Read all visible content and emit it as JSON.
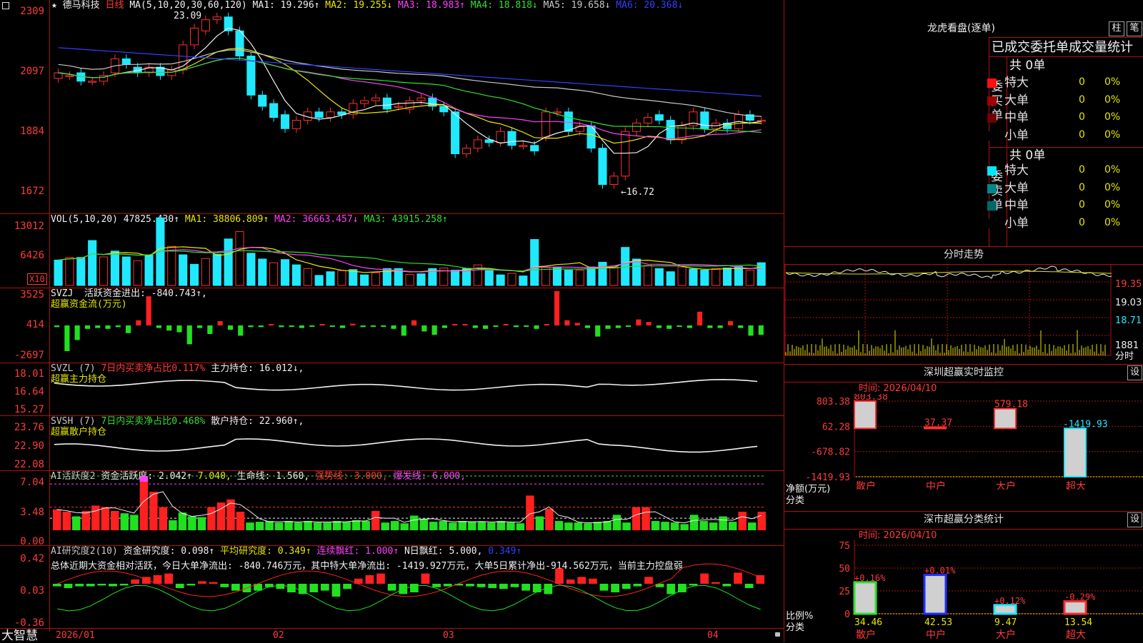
{
  "app": {
    "brand": "大智慧",
    "date_axis": [
      "2026/01",
      "02",
      "03",
      "04"
    ],
    "corner_icon": "lock-icon"
  },
  "kline": {
    "title_star": "★",
    "stock": "德马科技",
    "period": "日线",
    "ma_label": "MA(5,10,20,30,60,120)",
    "ma1": "MA1: 19.296↑",
    "ma2": "MA2: 19.255↓",
    "ma3": "MA3: 18.983↑",
    "ma4": "MA4: 18.818↓",
    "ma5": "MA5: 19.658↓",
    "ma6": "MA6: 20.368↓",
    "y_ticks": [
      "2309",
      "2097",
      "1884",
      "1672"
    ],
    "high_marker": "23.09",
    "low_marker": "←16.72",
    "closes": [
      21.0,
      20.9,
      20.7,
      20.7,
      20.9,
      21.5,
      21.3,
      21.0,
      21.2,
      20.9,
      21.1,
      22.0,
      22.6,
      22.9,
      23.0,
      22.5,
      21.6,
      20.2,
      19.8,
      19.4,
      19.0,
      19.3,
      19.6,
      19.4,
      19.6,
      19.5,
      19.9,
      20.0,
      20.1,
      19.7,
      19.8,
      20.0,
      20.1,
      19.8,
      19.6,
      18.1,
      18.3,
      18.6,
      18.5,
      18.9,
      18.4,
      18.4,
      18.2,
      19.6,
      19.6,
      18.9,
      19.1,
      18.3,
      17.0,
      17.3,
      18.9,
      19.2,
      19.4,
      19.3,
      18.6,
      19.1,
      19.6,
      19.0,
      19.2,
      19.0,
      19.5,
      19.3,
      19.3
    ],
    "opens": [
      20.8,
      20.9,
      21.0,
      20.7,
      20.7,
      21.0,
      21.5,
      21.2,
      21.0,
      21.2,
      20.9,
      21.1,
      22.0,
      22.5,
      22.9,
      23.0,
      22.5,
      21.6,
      20.2,
      19.9,
      19.5,
      19.0,
      19.3,
      19.6,
      19.4,
      19.6,
      19.5,
      19.9,
      20.0,
      20.1,
      19.8,
      19.7,
      20.0,
      20.1,
      19.8,
      19.6,
      18.1,
      18.3,
      18.6,
      18.5,
      18.9,
      18.4,
      18.4,
      18.7,
      19.6,
      19.6,
      18.9,
      19.1,
      18.3,
      17.0,
      17.3,
      18.9,
      19.2,
      19.5,
      19.3,
      18.6,
      19.1,
      19.6,
      19.0,
      19.2,
      19.0,
      19.5,
      19.3
    ]
  },
  "volume": {
    "label": "VOL(5,10,20)",
    "value": "47825.430↑",
    "ma1": "MA1: 38806.809↑",
    "ma2": "MA2: 36663.457↓",
    "ma3": "MA3: 43915.258↑",
    "y_ticks": [
      "13012",
      "6426"
    ],
    "unit": "X10",
    "bars": [
      4.8,
      5.3,
      5.3,
      8.5,
      5.4,
      6.5,
      5.4,
      4.7,
      5.8,
      12.8,
      7.4,
      5.8,
      4.0,
      5.1,
      5.9,
      8.8,
      10.2,
      6.1,
      5.0,
      4.3,
      4.9,
      3.9,
      3.2,
      1.9,
      2.6,
      2.8,
      3.0,
      2.0,
      2.4,
      3.2,
      3.2,
      2.1,
      2.2,
      3.2,
      3.3,
      2.9,
      3.2,
      3.9,
      2.8,
      2.0,
      2.3,
      1.8,
      8.7,
      3.5,
      3.5,
      2.9,
      2.9,
      3.5,
      4.4,
      3.5,
      7.2,
      5.0,
      3.8,
      3.2,
      2.6,
      3.5,
      3.1,
      2.9,
      3.2,
      3.3,
      3.6,
      2.9,
      4.3
    ]
  },
  "svzj": {
    "code": "SVZJ",
    "desc": "活跃资金进出: -840.743↑,",
    "sub": "超赢资金流(万元)",
    "y_ticks": [
      "3525",
      "414",
      "-2697"
    ],
    "bars": [
      -0.2,
      -3.0,
      -1.7,
      -0.4,
      -0.3,
      -0.4,
      -0.2,
      -0.9,
      0.6,
      3.4,
      -0.3,
      -0.6,
      -0.8,
      -2.2,
      -0.3,
      -1.0,
      0.5,
      -0.5,
      -1.2,
      -0.2,
      -0.2,
      0.1,
      -0.2,
      -0.1,
      -0.3,
      -0.1,
      0.1,
      -0.1,
      -0.3,
      0.2,
      -0.2,
      -0.1,
      -0.1,
      -0.4,
      -1.2,
      0.6,
      -0.7,
      -1.1,
      -0.3,
      0.1,
      0.0,
      -0.3,
      -0.4,
      -0.1,
      0.1,
      -0.2,
      -0.1,
      -0.4,
      0.1,
      4.0,
      0.6,
      0.3,
      -0.3,
      -1.3,
      -0.4,
      -0.3,
      -0.1,
      0.7,
      0.4,
      -0.3,
      -0.4,
      -0.1,
      -0.3,
      1.6,
      -0.3,
      -0.3,
      0.5,
      -0.3,
      -1.2,
      -1.1
    ]
  },
  "svzl": {
    "code": "SVZL (7)",
    "desc": "7日内买卖净占比0.117%",
    "hold": "主力持仓: 16.012↓,",
    "sub": "超赢主力持仓",
    "y_ticks": [
      "18.01",
      "16.64",
      "15.27"
    ]
  },
  "svsh": {
    "code": "SVSH (7)",
    "desc": "7日内买卖净占比0.468%",
    "hold": "散户持仓: 22.960↑,",
    "sub": "超赢散户持仓",
    "y_ticks": [
      "23.76",
      "22.90",
      "22.08"
    ]
  },
  "ai_active": {
    "code": "AI活跃度2",
    "v1": "资金活跃度: 2.042↑",
    "v2": "7.040,",
    "v3": "生命线: 1.560,",
    "v4": "强势线: 3.000,",
    "v5": "爆发线: 6.000,",
    "y_ticks": [
      "7.04",
      "3.48",
      "0.00"
    ],
    "bars": [
      2.7,
      2.4,
      1.8,
      2.5,
      3.2,
      3.0,
      2.5,
      2.2,
      2.0,
      7.0,
      5.0,
      3.0,
      1.3,
      2.3,
      1.8,
      1.7,
      3.0,
      3.6,
      4.0,
      2.4,
      1.0,
      1.1,
      1.2,
      1.0,
      1.2,
      1.0,
      1.2,
      1.0,
      1.0,
      1.2,
      1.1,
      1.3,
      1.2,
      2.5,
      1.0,
      1.2,
      0.9,
      1.9,
      1.5,
      1.1,
      1.2,
      1.0,
      1.2,
      1.1,
      1.1,
      1.0,
      1.2,
      1.0,
      0.9,
      4.5,
      1.8,
      2.8,
      1.2,
      1.0,
      1.0,
      0.9,
      1.1,
      1.2,
      2.0,
      1.0,
      3.0,
      3.0,
      1.2,
      1.1,
      1.0,
      0.8,
      2.0,
      1.2,
      1.0,
      1.8,
      1.1,
      2.4,
      1.0,
      2.4
    ]
  },
  "ai_research": {
    "code": "AI研究度2(10)",
    "v1": "资金研究度: 0.098↑",
    "v2": "平均研究度: 0.349↑",
    "v3": "连续飘红: 1.000↑",
    "v4": "N日飘红: 5.000,",
    "v5": "0.349↑",
    "comment": "总体近期大资金相对活跃，今日大单净流出: -840.746万元，其中特大单净流出: -1419.927万元，大单5日累计净出-914.562万元，当前主力控盘弱",
    "y_ticks": [
      "0.42",
      "0.03",
      "-0.36"
    ],
    "bars": [
      -0.03,
      -0.05,
      -0.03,
      -0.03,
      -0.02,
      -0.03,
      -0.02,
      0.05,
      0.08,
      0.1,
      0.12,
      -0.05,
      -0.02,
      0.03,
      0.02,
      -0.04,
      -0.08,
      -0.1,
      -0.08,
      -0.04,
      -0.06,
      -0.1,
      -0.12,
      -0.1,
      -0.08,
      -0.15,
      -0.06,
      0.06,
      0.1,
      0.12,
      -0.08,
      -0.12,
      -0.1,
      0.12,
      -0.04,
      -0.03,
      -0.02,
      -0.03,
      -0.04,
      -0.05,
      -0.06,
      -0.04,
      -0.08,
      -0.1,
      -0.12,
      0.18,
      0.05,
      0.08,
      0.06,
      -0.08,
      -0.1,
      -0.06,
      -0.03,
      0.08,
      -0.04,
      -0.12,
      -0.1,
      -0.02,
      0.12,
      0.02,
      -0.03,
      0.13,
      -0.05,
      0.1
    ]
  },
  "right": {
    "dragon_title": "龙虎看盘(逐单)",
    "btn_bar": "柱",
    "btn_pen": "笔",
    "table_title": "已成交委托单成交量统计",
    "buy_label": "委买单",
    "sell_label": "委卖单",
    "total": "共 0单",
    "buy_rows": [
      {
        "name": "特大",
        "val": "0",
        "pct": "0%",
        "color": "#ff1010"
      },
      {
        "name": "大单",
        "val": "0",
        "pct": "0%",
        "color": "#a00000"
      },
      {
        "name": "中单",
        "val": "0",
        "pct": "0%",
        "color": "#700000"
      },
      {
        "name": "小单",
        "val": "0",
        "pct": "0%",
        "color": "#000000"
      }
    ],
    "sell_rows": [
      {
        "name": "特大",
        "val": "0",
        "pct": "0%",
        "color": "#00e8ff"
      },
      {
        "name": "大单",
        "val": "0",
        "pct": "0%",
        "color": "#008888"
      },
      {
        "name": "中单",
        "val": "0",
        "pct": "0%",
        "color": "#006868"
      },
      {
        "name": "小单",
        "val": "0",
        "pct": "0%",
        "color": "#000000"
      }
    ],
    "intraday_title": "分时走势",
    "intraday_ticks": [
      "19.35",
      "19.03",
      "18.71",
      "1881",
      "分时"
    ],
    "sz_title": "深圳超赢实时监控",
    "btn_set": "设",
    "time": "时间: 2026/04/10",
    "sz_ticks": [
      "803.38",
      "62.28",
      "-678.82",
      "-1419.93"
    ],
    "net_label": "净额(万元)",
    "cat_label": "分类",
    "sz_bars": [
      {
        "name": "散户",
        "val": "803.38",
        "num": 803.38
      },
      {
        "name": "中户",
        "val": "37.37",
        "num": 37.37
      },
      {
        "name": "大户",
        "val": "579.18",
        "num": 579.18
      },
      {
        "name": "超大",
        "val": "-1419.93",
        "num": -1419.93
      }
    ],
    "cls_title": "深市超赢分类统计",
    "cls_ticks": [
      "75",
      "50",
      "25",
      "0"
    ],
    "ratio_label": "比例%",
    "cls_bars": [
      {
        "name": "散户",
        "pct": "+0.16%",
        "val": "34.46",
        "num": 34.46
      },
      {
        "name": "中户",
        "pct": "+0.01%",
        "val": "42.53",
        "num": 42.53
      },
      {
        "name": "大户",
        "pct": "+0.12%",
        "val": "9.47",
        "num": 9.47
      },
      {
        "name": "超大",
        "pct": "-0.29%",
        "val": "13.54",
        "num": 13.54
      }
    ]
  }
}
